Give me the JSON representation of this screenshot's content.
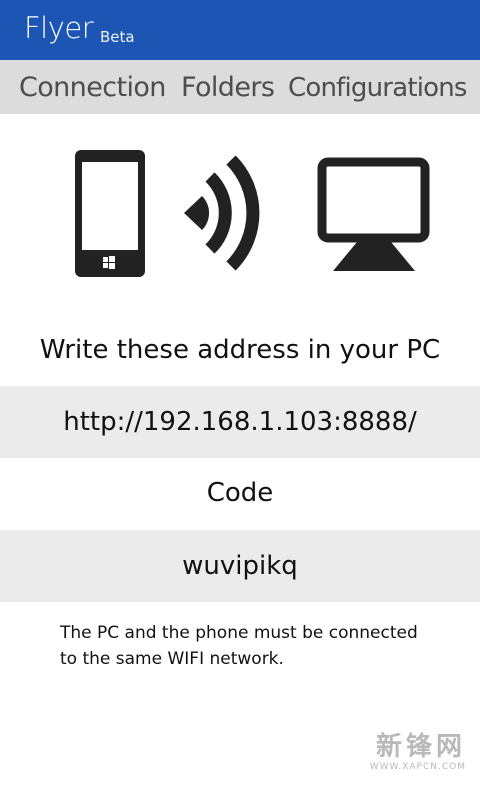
{
  "app": {
    "title": "Flyer",
    "badge": "Beta",
    "accent_color": "#1c55b3"
  },
  "tabs": [
    {
      "label": "Connection",
      "selected": true
    },
    {
      "label": "Folders",
      "selected": false
    },
    {
      "label": "Configurations",
      "selected": false
    }
  ],
  "illustration": {
    "icons": [
      "phone-icon",
      "wifi-signal-icon",
      "monitor-icon"
    ]
  },
  "connection": {
    "instruction": "Write these address in your PC",
    "address": "http://192.168.1.103:8888/",
    "code_label": "Code",
    "code": "wuvipikq",
    "note": "The PC and the phone must be connected to the same WIFI network."
  },
  "watermark": {
    "text": "新锋网",
    "url": "WWW.XAPCN.COM"
  }
}
